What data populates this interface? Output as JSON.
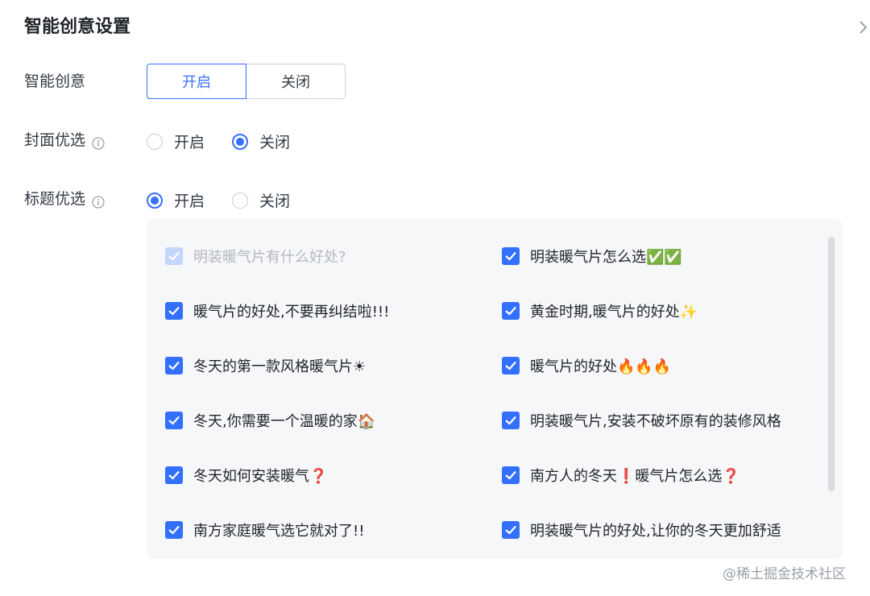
{
  "panel": {
    "title": "智能创意设置"
  },
  "smart_creative": {
    "label": "智能创意",
    "on_label": "开启",
    "off_label": "关闭",
    "selected": "开启"
  },
  "cover_pick": {
    "label": "封面优选",
    "on_label": "开启",
    "off_label": "关闭",
    "selected": "关闭"
  },
  "title_pick": {
    "label": "标题优选",
    "on_label": "开启",
    "off_label": "关闭",
    "selected": "开启"
  },
  "titles": {
    "left": [
      {
        "text": "明装暖气片有什么好处?",
        "checked": true,
        "disabled": true
      },
      {
        "text": "暖气片的好处,不要再纠结啦!!!",
        "checked": true,
        "disabled": false
      },
      {
        "text": "冬天的第一款风格暖气片☀",
        "checked": true,
        "disabled": false
      },
      {
        "text": "冬天,你需要一个温暖的家🏠",
        "checked": true,
        "disabled": false
      },
      {
        "text": "冬天如何安装暖气❓",
        "checked": true,
        "disabled": false
      },
      {
        "text": "南方家庭暖气选它就对了!!",
        "checked": true,
        "disabled": false
      }
    ],
    "right": [
      {
        "text": "明装暖气片怎么选✅✅",
        "checked": true,
        "disabled": false
      },
      {
        "text": "黄金时期,暖气片的好处✨",
        "checked": true,
        "disabled": false
      },
      {
        "text": "暖气片的好处🔥🔥🔥",
        "checked": true,
        "disabled": false
      },
      {
        "text": "明装暖气片,安装不破坏原有的装修风格",
        "checked": true,
        "disabled": false
      },
      {
        "text": "南方人的冬天❗暖气片怎么选❓",
        "checked": true,
        "disabled": false
      },
      {
        "text": "明装暖气片的好处,让你的冬天更加舒适",
        "checked": true,
        "disabled": false
      }
    ]
  },
  "watermark": "@稀土掘金技术社区",
  "colors": {
    "accent": "#3370ff",
    "accent_disabled": "#c4d6fb",
    "box_background": "#f6f7f9",
    "text": "#1f2329"
  },
  "icons": {
    "panel_chevron": "chevron-right-icon",
    "info": "info-circle-icon",
    "check": "checkmark-icon"
  }
}
